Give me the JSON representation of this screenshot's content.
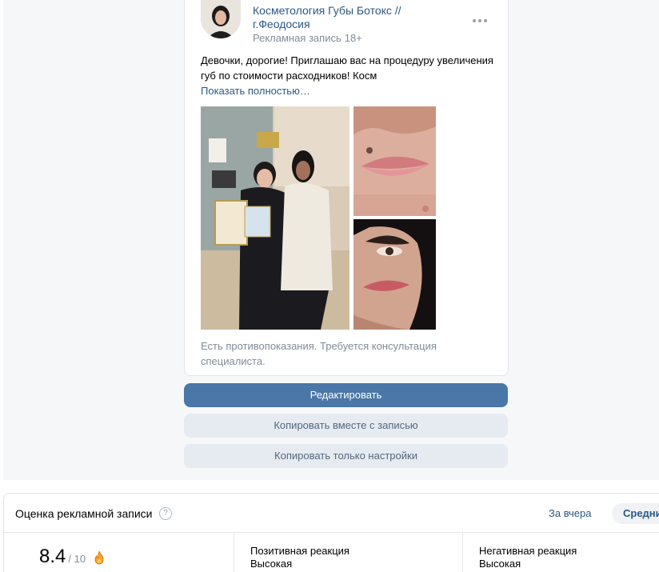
{
  "post": {
    "group_name": "Косметология Губы Ботокс // г.Феодосия",
    "ad_label": "Рекламная запись",
    "age_rating": "18+",
    "text": "Девочки, дорогие! Приглашаю вас на процедуру увеличения губ по стоимости расходников! Косм",
    "show_more": "Показать полностью…",
    "disclaimer": "Есть противопоказания. Требуется консультация специалиста."
  },
  "actions": {
    "edit": "Редактировать",
    "copy_with_post": "Копировать вместе с записью",
    "copy_settings_only": "Копировать только настройки"
  },
  "rating": {
    "title": "Оценка рекламной записи",
    "help": "?",
    "period_yesterday": "За вчера",
    "period_avg": "Средни",
    "score": "8.4",
    "scale": "/ 10",
    "positive_label": "Позитивная реакция",
    "positive_value": "Высокая",
    "negative_label": "Негативная реакция",
    "negative_value": "Высокая"
  },
  "colors": {
    "link": "#2a5885",
    "primary_button": "#4a76a8",
    "secondary_button": "#e5ebf1",
    "muted_text": "#818c99"
  }
}
